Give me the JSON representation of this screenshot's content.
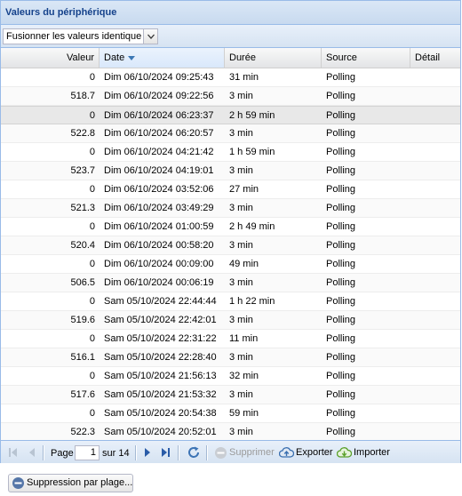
{
  "panel": {
    "title": "Valeurs du périphérique"
  },
  "toolbar": {
    "merge_combo_value": "Fusionner les valeurs identiques"
  },
  "columns": {
    "value": "Valeur",
    "date": "Date",
    "duration": "Durée",
    "source": "Source",
    "detail": "Détail"
  },
  "sort": {
    "column": "Date",
    "direction": "descending"
  },
  "rows": [
    {
      "value": "0",
      "date": "Dim 06/10/2024 09:25:43",
      "duration": "31 min",
      "source": "Polling",
      "detail": ""
    },
    {
      "value": "518.7",
      "date": "Dim 06/10/2024 09:22:56",
      "duration": "3 min",
      "source": "Polling",
      "detail": ""
    },
    {
      "value": "0",
      "date": "Dim 06/10/2024 06:23:37",
      "duration": "2 h 59 min",
      "source": "Polling",
      "detail": "",
      "selected": true
    },
    {
      "value": "522.8",
      "date": "Dim 06/10/2024 06:20:57",
      "duration": "3 min",
      "source": "Polling",
      "detail": ""
    },
    {
      "value": "0",
      "date": "Dim 06/10/2024 04:21:42",
      "duration": "1 h 59 min",
      "source": "Polling",
      "detail": ""
    },
    {
      "value": "523.7",
      "date": "Dim 06/10/2024 04:19:01",
      "duration": "3 min",
      "source": "Polling",
      "detail": ""
    },
    {
      "value": "0",
      "date": "Dim 06/10/2024 03:52:06",
      "duration": "27 min",
      "source": "Polling",
      "detail": ""
    },
    {
      "value": "521.3",
      "date": "Dim 06/10/2024 03:49:29",
      "duration": "3 min",
      "source": "Polling",
      "detail": ""
    },
    {
      "value": "0",
      "date": "Dim 06/10/2024 01:00:59",
      "duration": "2 h 49 min",
      "source": "Polling",
      "detail": ""
    },
    {
      "value": "520.4",
      "date": "Dim 06/10/2024 00:58:20",
      "duration": "3 min",
      "source": "Polling",
      "detail": ""
    },
    {
      "value": "0",
      "date": "Dim 06/10/2024 00:09:00",
      "duration": "49 min",
      "source": "Polling",
      "detail": ""
    },
    {
      "value": "506.5",
      "date": "Dim 06/10/2024 00:06:19",
      "duration": "3 min",
      "source": "Polling",
      "detail": ""
    },
    {
      "value": "0",
      "date": "Sam 05/10/2024 22:44:44",
      "duration": "1 h 22 min",
      "source": "Polling",
      "detail": ""
    },
    {
      "value": "519.6",
      "date": "Sam 05/10/2024 22:42:01",
      "duration": "3 min",
      "source": "Polling",
      "detail": ""
    },
    {
      "value": "0",
      "date": "Sam 05/10/2024 22:31:22",
      "duration": "11 min",
      "source": "Polling",
      "detail": ""
    },
    {
      "value": "516.1",
      "date": "Sam 05/10/2024 22:28:40",
      "duration": "3 min",
      "source": "Polling",
      "detail": ""
    },
    {
      "value": "0",
      "date": "Sam 05/10/2024 21:56:13",
      "duration": "32 min",
      "source": "Polling",
      "detail": ""
    },
    {
      "value": "517.6",
      "date": "Sam 05/10/2024 21:53:32",
      "duration": "3 min",
      "source": "Polling",
      "detail": ""
    },
    {
      "value": "0",
      "date": "Sam 05/10/2024 20:54:38",
      "duration": "59 min",
      "source": "Polling",
      "detail": ""
    },
    {
      "value": "522.3",
      "date": "Sam 05/10/2024 20:52:01",
      "duration": "3 min",
      "source": "Polling",
      "detail": ""
    }
  ],
  "pager": {
    "page_label": "Page",
    "current_page": "1",
    "of_label": "sur 14",
    "delete_label": "Supprimer",
    "export_label": "Exporter",
    "import_label": "Importer"
  },
  "footer": {
    "range_delete_label": "Suppression par plage..."
  },
  "colors": {
    "header_text": "#15428b",
    "border": "#99bbe8",
    "export_icon": "#3a6fb0",
    "import_icon": "#5aa02c",
    "disabled": "#9a9a9a"
  },
  "icons": [
    "first-page-icon",
    "prev-page-icon",
    "next-page-icon",
    "last-page-icon",
    "refresh-icon",
    "delete-icon",
    "export-cloud-icon",
    "import-cloud-icon",
    "sort-desc-icon",
    "chevron-down-icon"
  ]
}
